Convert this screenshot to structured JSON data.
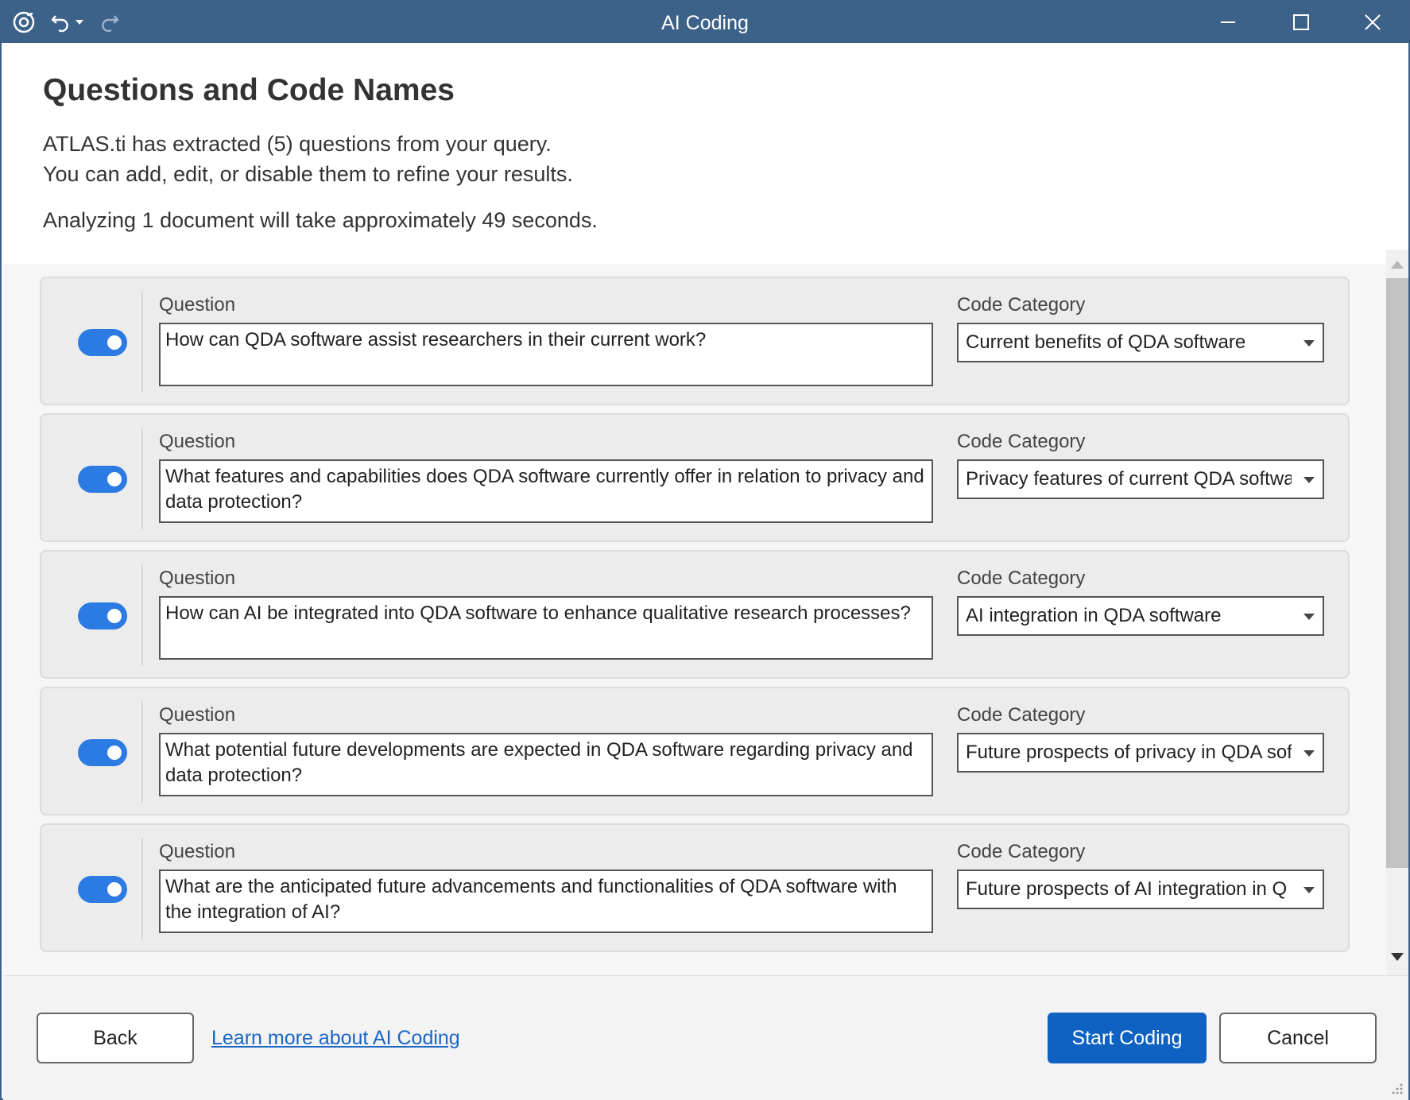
{
  "window": {
    "title": "AI Coding"
  },
  "header": {
    "title": "Questions and Code Names",
    "line1": "ATLAS.ti has extracted (5) questions from your query.",
    "line2": "You can add, edit, or disable them to refine your results.",
    "line3": "Analyzing 1 document will take approximately 49 seconds."
  },
  "labels": {
    "question": "Question",
    "code_category": "Code Category"
  },
  "questions": [
    {
      "enabled": true,
      "question": "How can QDA software assist researchers in their current work?",
      "category": "Current benefits of QDA software"
    },
    {
      "enabled": true,
      "question": "What features and capabilities does QDA software currently offer in relation to privacy and data protection?",
      "category": "Privacy features of current QDA softwa"
    },
    {
      "enabled": true,
      "question": "How can AI be integrated into QDA software to enhance qualitative research processes?",
      "category": "AI integration in QDA software"
    },
    {
      "enabled": true,
      "question": "What potential future developments are expected in QDA software regarding privacy and data protection?",
      "category": "Future prospects of privacy in QDA sof"
    },
    {
      "enabled": true,
      "question": "What are the anticipated future advancements and functionalities of QDA software with the integration of AI?",
      "category": "Future prospects of AI integration in Q"
    }
  ],
  "footer": {
    "back_label": "Back",
    "learn_more_label": "Learn more about AI Coding",
    "start_label": "Start Coding",
    "cancel_label": "Cancel"
  },
  "colors": {
    "titlebar": "#3d6289",
    "toggle_on": "#2b7be3",
    "primary_button": "#0f62c1",
    "link": "#1a66c5"
  },
  "icons": {
    "app": "app-logo-icon",
    "undo": "undo-icon",
    "undo_dropdown": "caret-down-icon",
    "redo": "redo-icon",
    "minimize": "minimize-icon",
    "maximize": "maximize-icon",
    "close": "close-icon"
  }
}
